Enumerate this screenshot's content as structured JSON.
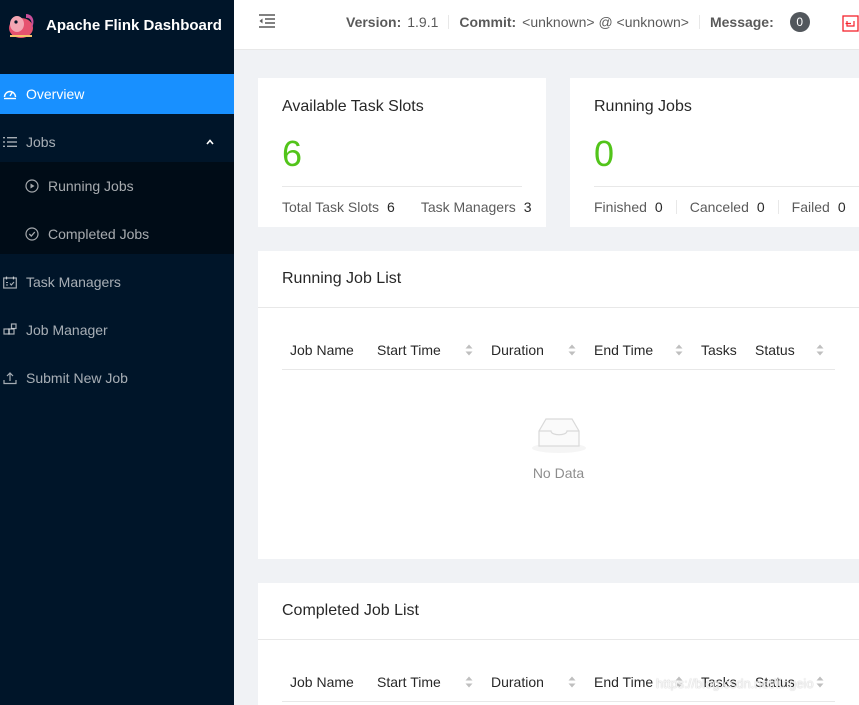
{
  "app": {
    "title": "Apache Flink Dashboard"
  },
  "sidebar": {
    "items": [
      {
        "label": "Overview",
        "icon": "dashboard-icon",
        "active": true
      },
      {
        "label": "Jobs",
        "icon": "bars-icon",
        "expanded": true,
        "children": [
          {
            "label": "Running Jobs",
            "icon": "play-circle-icon"
          },
          {
            "label": "Completed Jobs",
            "icon": "check-circle-icon"
          }
        ]
      },
      {
        "label": "Task Managers",
        "icon": "schedule-icon"
      },
      {
        "label": "Job Manager",
        "icon": "build-icon"
      },
      {
        "label": "Submit New Job",
        "icon": "upload-icon"
      }
    ]
  },
  "header": {
    "version_label": "Version:",
    "version": "1.9.1",
    "commit_label": "Commit:",
    "commit": "<unknown> @ <unknown>",
    "message_label": "Message:",
    "message_count": "0"
  },
  "slots_card": {
    "title": "Available Task Slots",
    "value": "6",
    "total_label": "Total Task Slots",
    "total": "6",
    "tm_label": "Task Managers",
    "tm": "3"
  },
  "jobs_card": {
    "title": "Running Jobs",
    "value": "0",
    "finished_label": "Finished",
    "finished": "0",
    "canceled_label": "Canceled",
    "canceled": "0",
    "failed_label": "Failed",
    "failed": "0"
  },
  "running_list": {
    "title": "Running Job List",
    "columns": [
      "Job Name",
      "Start Time",
      "Duration",
      "End Time",
      "Tasks",
      "Status"
    ],
    "empty_text": "No Data"
  },
  "completed_list": {
    "title": "Completed Job List",
    "columns": [
      "Job Name",
      "Start Time",
      "Duration",
      "End Time",
      "Tasks",
      "Status"
    ]
  },
  "watermark": "https://blog.csdn.net/lingeio",
  "colors": {
    "sidebar": "#001529",
    "active": "#1890ff",
    "stat": "#52c41a"
  }
}
